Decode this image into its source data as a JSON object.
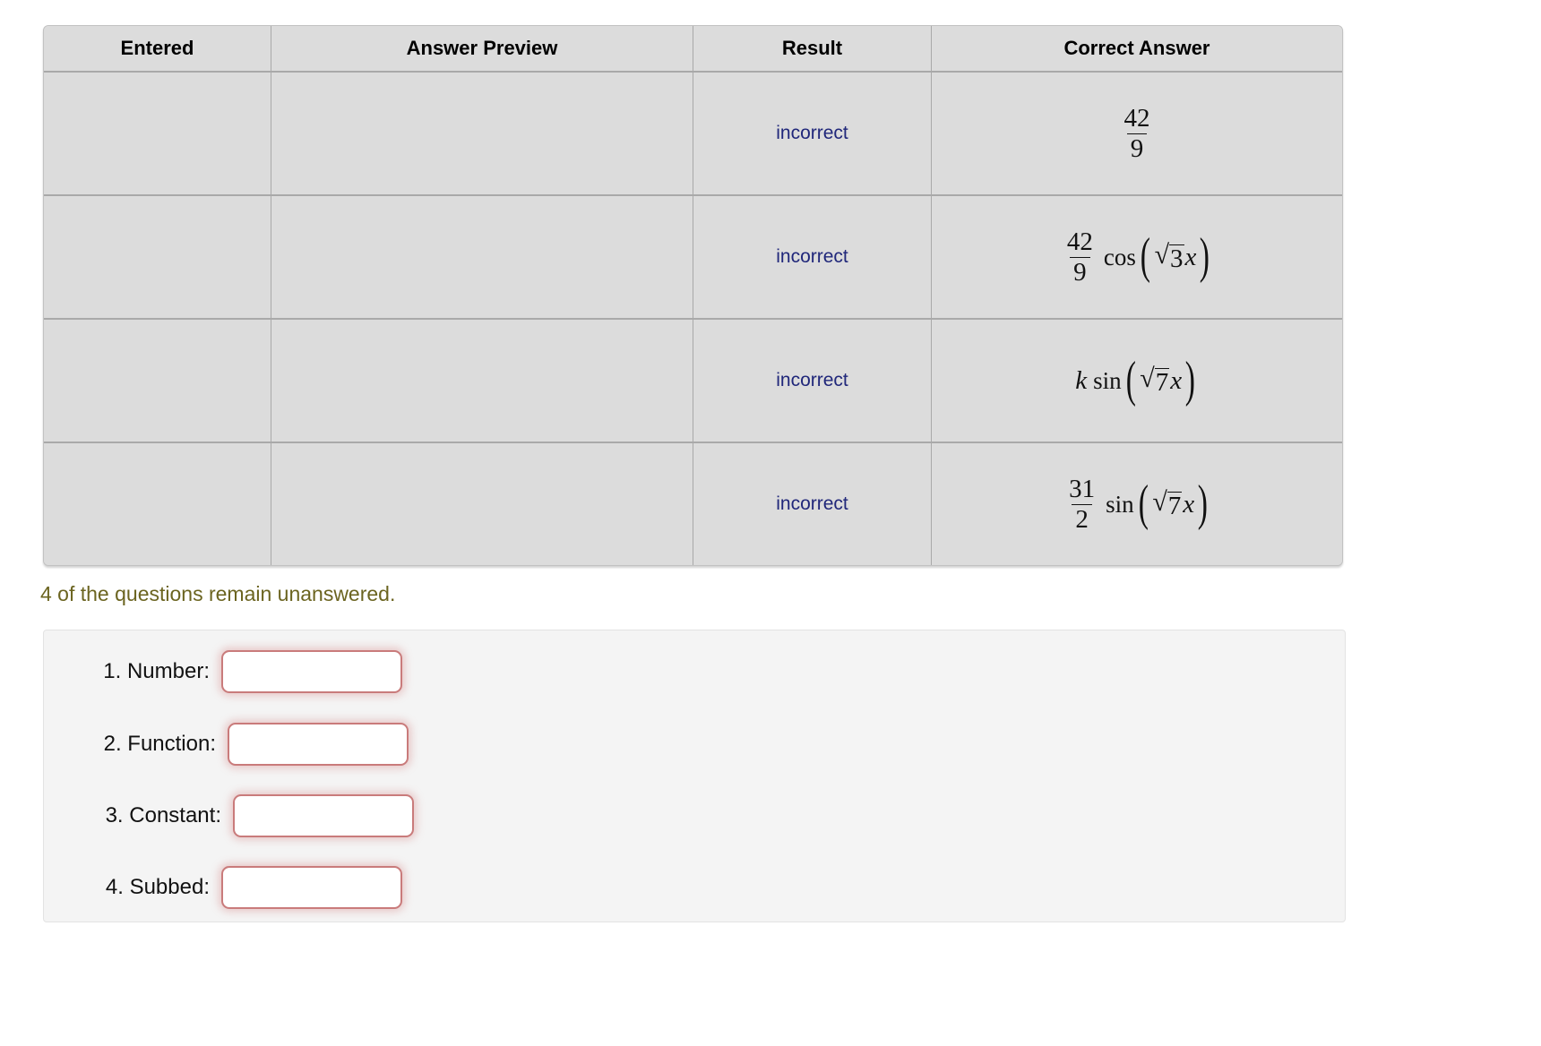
{
  "table": {
    "headers": [
      "Entered",
      "Answer Preview",
      "Result",
      "Correct Answer"
    ],
    "rows": [
      {
        "entered": "",
        "answer_preview": "",
        "result": "incorrect",
        "correct_answer_text": "42/9",
        "correct_answer": {
          "kind": "fraction",
          "numerator": "42",
          "denominator": "9"
        }
      },
      {
        "entered": "",
        "answer_preview": "",
        "result": "incorrect",
        "correct_answer_text": "(42/9) cos(sqrt(3) x)",
        "correct_answer": {
          "kind": "fraction-times-trig",
          "numerator": "42",
          "denominator": "9",
          "function": "cos",
          "radicand": "3",
          "variable": "x"
        }
      },
      {
        "entered": "",
        "answer_preview": "",
        "result": "incorrect",
        "correct_answer_text": "k sin(sqrt(7) x)",
        "correct_answer": {
          "kind": "coefficient-times-trig",
          "coefficient": "k",
          "function": "sin",
          "radicand": "7",
          "variable": "x"
        }
      },
      {
        "entered": "",
        "answer_preview": "",
        "result": "incorrect",
        "correct_answer_text": "(31/2) sin(sqrt(7) x)",
        "correct_answer": {
          "kind": "fraction-times-trig",
          "numerator": "31",
          "denominator": "2",
          "function": "sin",
          "radicand": "7",
          "variable": "x"
        }
      }
    ]
  },
  "status": {
    "message": "4 of the questions remain unanswered."
  },
  "answer_form": {
    "fields": [
      {
        "label": "1. Number:",
        "value": "",
        "placeholder": ""
      },
      {
        "label": "2. Function:",
        "value": "",
        "placeholder": ""
      },
      {
        "label": "3. Constant:",
        "value": "",
        "placeholder": ""
      },
      {
        "label": "4. Subbed:",
        "value": "",
        "placeholder": ""
      }
    ]
  },
  "colors": {
    "result_incorrect_bg": "#cf9292",
    "result_incorrect_text": "#20277a",
    "cell_bg": "#dcdcdc",
    "status_text": "#6b6420",
    "input_border": "#c97b7b",
    "panel_bg": "#f4f4f4"
  }
}
